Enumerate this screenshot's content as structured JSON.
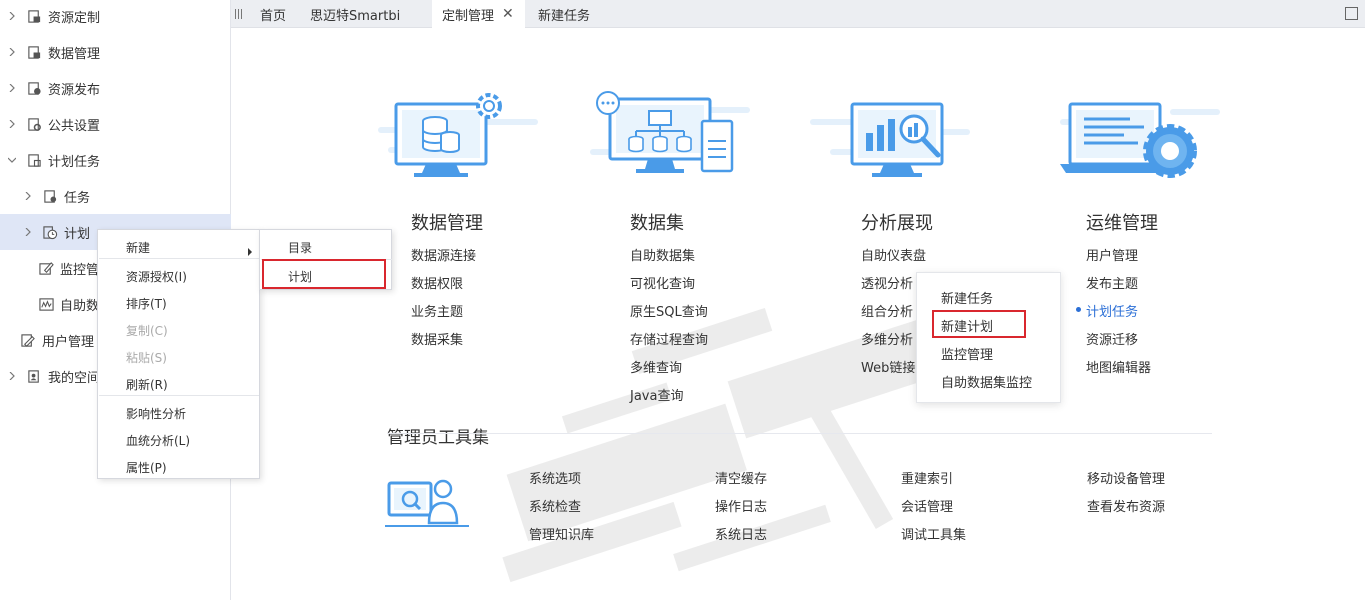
{
  "sidebar": {
    "items": [
      {
        "label": "资源定制",
        "icon": "resource-custom-icon"
      },
      {
        "label": "数据管理",
        "icon": "data-manage-icon"
      },
      {
        "label": "资源发布",
        "icon": "resource-publish-icon"
      },
      {
        "label": "公共设置",
        "icon": "settings-icon"
      },
      {
        "label": "计划任务",
        "icon": "schedule-icon"
      },
      {
        "label": "任务",
        "icon": "task-icon"
      },
      {
        "label": "计划",
        "icon": "plan-clock-icon"
      },
      {
        "label": "监控管",
        "icon": "monitor-edit-icon"
      },
      {
        "label": "自助数",
        "icon": "wave-chart-icon"
      },
      {
        "label": "用户管理",
        "icon": "user-manage-icon"
      },
      {
        "label": "我的空间",
        "icon": "my-space-icon"
      }
    ]
  },
  "tabs": [
    {
      "label": "首页"
    },
    {
      "label": "思迈特Smartbi"
    },
    {
      "label": "定制管理"
    },
    {
      "label": "新建任务"
    }
  ],
  "tab_close": "✕",
  "cards": [
    {
      "title": "数据管理",
      "links": [
        "数据源连接",
        "数据权限",
        "业务主题",
        "数据采集"
      ]
    },
    {
      "title": "数据集",
      "links": [
        "自助数据集",
        "可视化查询",
        "原生SQL查询",
        "存储过程查询",
        "多维查询",
        "Java查询"
      ]
    },
    {
      "title": "分析展现",
      "links": [
        "自助仪表盘",
        "透视分析",
        "组合分析",
        "多维分析",
        "Web链接"
      ]
    },
    {
      "title": "运维管理",
      "links": [
        "用户管理",
        "发布主题",
        "计划任务",
        "资源迁移",
        "地图编辑器"
      ]
    }
  ],
  "admin_tools": {
    "title": "管理员工具集",
    "columns": [
      [
        "系统选项",
        "系统检查",
        "管理知识库"
      ],
      [
        "清空缓存",
        "操作日志",
        "系统日志"
      ],
      [
        "重建索引",
        "会话管理",
        "调试工具集"
      ],
      [
        "移动设备管理",
        "查看发布资源"
      ]
    ]
  },
  "popup": {
    "items": [
      "新建任务",
      "新建计划",
      "监控管理",
      "自助数据集监控"
    ]
  },
  "context_menu": {
    "items": [
      {
        "label": "新建"
      },
      {
        "label": "资源授权(I)"
      },
      {
        "label": "排序(T)"
      },
      {
        "label": "复制(C)"
      },
      {
        "label": "粘贴(S)"
      },
      {
        "label": "刷新(R)"
      },
      {
        "label": "影响性分析"
      },
      {
        "label": "血统分析(L)"
      },
      {
        "label": "属性(P)"
      }
    ]
  },
  "submenu": {
    "items": [
      "目录",
      "计划"
    ]
  },
  "colors": {
    "accent": "#2b6fd6",
    "highlight_box": "#d9272e",
    "illustration": "#4a9be8"
  }
}
